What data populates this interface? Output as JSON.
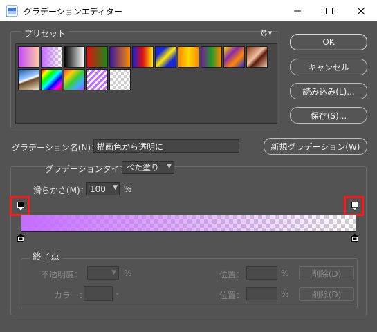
{
  "window": {
    "title": "グラデーションエディター",
    "minimize_icon": "minimize-icon",
    "maximize_icon": "maximize-icon",
    "close_icon": "close-icon"
  },
  "presets": {
    "label": "プリセット",
    "gear_icon": "gear-icon",
    "swatches": [
      {
        "name": "foreground-to-background",
        "css": "linear-gradient(90deg,#c44bff,#ffc8a0)"
      },
      {
        "name": "foreground-to-transparent",
        "css": "linear-gradient(90deg,#c46cff,rgba(196,108,255,0))"
      },
      {
        "name": "black-white",
        "css": "linear-gradient(90deg,#000,#fff)"
      },
      {
        "name": "red-green",
        "css": "linear-gradient(90deg,#e01010,#1a8a1a)"
      },
      {
        "name": "violet-orange",
        "css": "linear-gradient(90deg,#3a18a0,#ff8a00)"
      },
      {
        "name": "blue-red-yellow",
        "css": "linear-gradient(90deg,#1c1cd8,#e01010,#ffe600)"
      },
      {
        "name": "blue-yellow-blue",
        "css": "linear-gradient(135deg,#1a2ad8 0%,#1a2ad8 25%,#ffec00 50%,#1a2ad8 75%,#1a2ad8 100%)"
      },
      {
        "name": "orange-yellow-orange",
        "css": "linear-gradient(90deg,#ff8a00,#ffd800,#ff8a00)"
      },
      {
        "name": "violet-green-orange",
        "css": "linear-gradient(90deg,#7a1a9a,#1f9a2a,#ff8a00)"
      },
      {
        "name": "yellow-violet-orange-blue",
        "css": "linear-gradient(135deg,#ffd800 0%,#8a2aa8 35%,#ff8a00 65%,#1a2ad8 100%)"
      },
      {
        "name": "copper",
        "css": "linear-gradient(135deg,#8a3a1a,#f0c0a0 45%,#5a1a0a 60%,#f2c8b0)"
      },
      {
        "name": "chrome",
        "css": "linear-gradient(160deg,#1a5aa8 0%,#9ac8ff 40%,#ffffff 48%,#6a4a2a 55%,#f0e0c0 100%)"
      },
      {
        "name": "spectrum",
        "css": "linear-gradient(135deg,#ff0000,#ffff00,#00ff00,#00ffff,#0000ff,#ff00ff,#ff0000)"
      },
      {
        "name": "transparent-rainbow",
        "css": "linear-gradient(135deg,#ff3a3a,#ffd000,#3acf3a,#3ab0ff,#b04aff)"
      },
      {
        "name": "transparent-stripes",
        "css": "repeating-linear-gradient(135deg,#c46cff 0 3px,#ffffff 3px 6px)"
      },
      {
        "name": "checker-transparent",
        "css": "linear-gradient(45deg,#cfcfcf 25%,transparent 25%,transparent 75%,#cfcfcf 75%),linear-gradient(45deg,#cfcfcf 25%,#ffffff 25%,#ffffff 75%,#cfcfcf 75%)"
      }
    ]
  },
  "buttons": {
    "ok": "OK",
    "cancel": "キャンセル",
    "load": "読み込み(L)...",
    "save": "保存(S)...",
    "new": "新規グラデーション(W)"
  },
  "name": {
    "label": "グラデーション名(N)：",
    "value": "描画色から透明に"
  },
  "gradient": {
    "type_label": "グラデーションタイプ：",
    "type_value": "べた塗り",
    "smoothness_label": "滑らかさ(M)：",
    "smoothness_value": "100",
    "smoothness_unit": "%",
    "color": "#c46cff",
    "start_opacity": 1,
    "end_opacity": 0
  },
  "stops": {
    "label": "終了点",
    "opacity_label": "不透明度：",
    "opacity_unit": "%",
    "opacity_location_label": "位置：",
    "opacity_location_unit": "%",
    "opacity_delete": "削除(D)",
    "color_label": "カラー：",
    "color_location_label": "位置：",
    "color_location_unit": "%",
    "color_delete": "削除(D)"
  },
  "colors": {
    "dialog_bg": "#535353",
    "highlight_red": "#ff1a1a"
  }
}
